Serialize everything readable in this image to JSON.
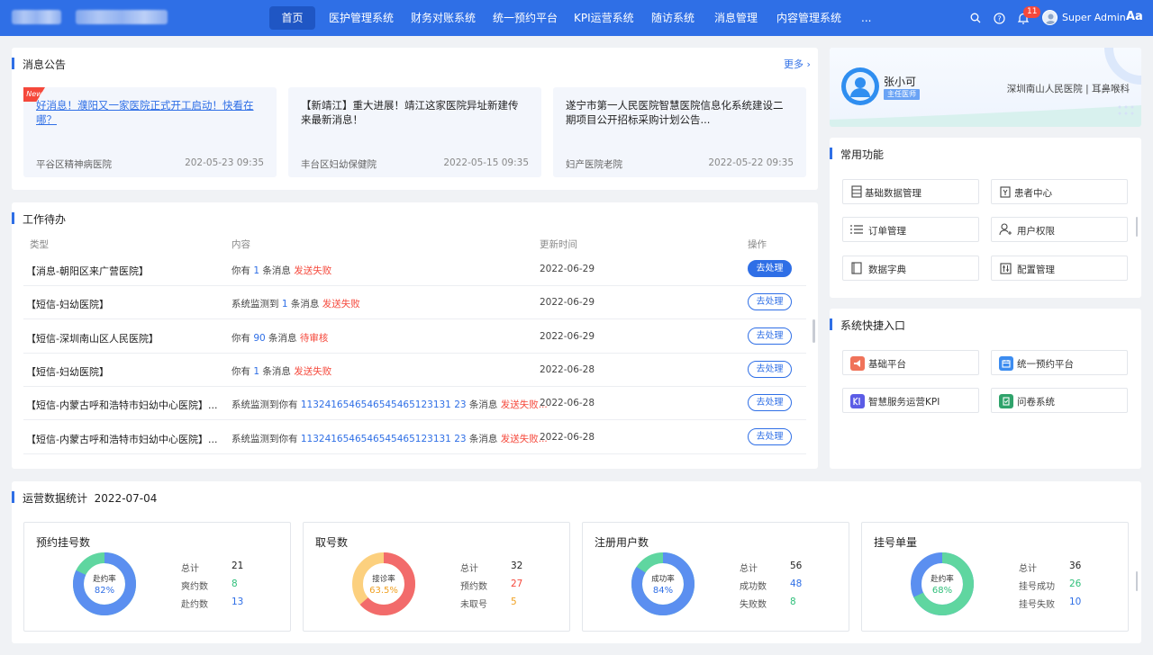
{
  "nav": {
    "items": [
      "首页",
      "医护管理系统",
      "财务对账系统",
      "统一预约平台",
      "KPI运营系统",
      "随访系统",
      "消息管理",
      "内容管理系统",
      "..."
    ],
    "active_index": 0,
    "notification_count": "11",
    "user_name": "Super Admin",
    "font_toggle": "Aa"
  },
  "notices": {
    "title": "消息公告",
    "more": "更多",
    "new_tag": "New",
    "items": [
      {
        "text": "好消息！濮阳又一家医院正式开工启动！快看在哪？",
        "source": "平谷区精神病医院",
        "time": "202-05-23 09:35"
      },
      {
        "text": "【新靖江】重大进展！靖江这家医院异址新建传来最新消息！",
        "source": "丰台区妇幼保健院",
        "time": "2022-05-15 09:35"
      },
      {
        "text": "遂宁市第一人民医院智慧医院信息化系统建设二期项目公开招标采购计划公告...",
        "source": "妇产医院老院",
        "time": "2022-05-22 09:35"
      }
    ]
  },
  "todo": {
    "title": "工作待办",
    "headers": {
      "type": "类型",
      "content": "内容",
      "time": "更新时间",
      "action": "操作"
    },
    "rows": [
      {
        "type": "【消息-朝阳区来广营医院】",
        "pre": "你有 ",
        "num": "1",
        "mid": " 条消息 ",
        "status": "发送失败",
        "time": "2022-06-29",
        "action": "去处理"
      },
      {
        "type": "【短信-妇幼医院】",
        "pre": "系统监测到 ",
        "num": "1",
        "mid": " 条消息 ",
        "status": "发送失败",
        "time": "2022-06-29",
        "action": "去处理"
      },
      {
        "type": "【短信-深圳南山区人民医院】",
        "pre": "你有 ",
        "num": "90",
        "mid": " 条消息 ",
        "status": "待审核",
        "time": "2022-06-29",
        "action": "去处理"
      },
      {
        "type": "【短信-妇幼医院】",
        "pre": "你有 ",
        "num": "1",
        "mid": " 条消息 ",
        "status": "发送失败",
        "time": "2022-06-28",
        "action": "去处理"
      },
      {
        "type": "【短信-内蒙古呼和浩特市妇幼中心医院】...",
        "pre": "系统监测到你有 ",
        "num": "1132416546546545465123131 23",
        "mid": " 条消息 ",
        "status": "发送失败...",
        "time": "2022-06-28",
        "action": "去处理"
      },
      {
        "type": "【短信-内蒙古呼和浩特市妇幼中心医院】...",
        "pre": "系统监测到你有 ",
        "num": "1132416546546545465123131 23",
        "mid": " 条消息 ",
        "status": "发送失败...",
        "time": "2022-06-28",
        "action": "去处理"
      }
    ]
  },
  "profile": {
    "name": "张小可",
    "role": "主任医师",
    "hospital": "深圳南山人民医院 | 耳鼻喉科"
  },
  "common": {
    "title": "常用功能",
    "items": [
      {
        "label": "基础数据管理",
        "icon": "database-icon"
      },
      {
        "label": "患者中心",
        "icon": "patient-icon"
      },
      {
        "label": "订单管理",
        "icon": "list-icon"
      },
      {
        "label": "用户权限",
        "icon": "user-permission-icon"
      },
      {
        "label": "数据字典",
        "icon": "dictionary-icon"
      },
      {
        "label": "配置管理",
        "icon": "settings-icon"
      }
    ]
  },
  "quick": {
    "title": "系统快捷入口",
    "items": [
      {
        "label": "基础平台",
        "icon": "megaphone-icon",
        "color": "#f0735a"
      },
      {
        "label": "统一预约平台",
        "icon": "calendar-icon",
        "color": "#3c8cf0"
      },
      {
        "label": "智慧服务运营KPI",
        "icon": "kpi-icon",
        "color": "#5b5ce6"
      },
      {
        "label": "问卷系统",
        "icon": "survey-icon",
        "color": "#2fa36b"
      }
    ]
  },
  "stats": {
    "title": "运营数据统计",
    "date": "2022-07-04",
    "cards": [
      {
        "title": "预约挂号数",
        "center_label": "赴约率",
        "center_value": "82%",
        "pct": 82,
        "main_color": "#5b8ff0",
        "rest_color": "#5fd6a0",
        "value_color": "#2f6fe6",
        "kv": [
          {
            "k": "总计",
            "v": "21",
            "c": "#222"
          },
          {
            "k": "爽约数",
            "v": "8",
            "c": "#2fbf7a"
          },
          {
            "k": "赴约数",
            "v": "13",
            "c": "#2f6fe6"
          }
        ]
      },
      {
        "title": "取号数",
        "center_label": "接诊率",
        "center_value": "63.5%",
        "pct": 63.5,
        "main_color": "#f26b6b",
        "rest_color": "#fcd07e",
        "value_color": "#f0a020",
        "kv": [
          {
            "k": "总计",
            "v": "32",
            "c": "#222"
          },
          {
            "k": "预约数",
            "v": "27",
            "c": "#f5483b"
          },
          {
            "k": "未取号",
            "v": "5",
            "c": "#f0a020"
          }
        ]
      },
      {
        "title": "注册用户数",
        "center_label": "成功率",
        "center_value": "84%",
        "pct": 84,
        "main_color": "#5b8ff0",
        "rest_color": "#5fd6a0",
        "value_color": "#2f6fe6",
        "kv": [
          {
            "k": "总计",
            "v": "56",
            "c": "#222"
          },
          {
            "k": "成功数",
            "v": "48",
            "c": "#2f6fe6"
          },
          {
            "k": "失败数",
            "v": "8",
            "c": "#2fbf7a"
          }
        ]
      },
      {
        "title": "挂号单量",
        "center_label": "赴约率",
        "center_value": "68%",
        "pct": 68,
        "main_color": "#5fd6a0",
        "rest_color": "#5b8ff0",
        "value_color": "#2fbf7a",
        "kv": [
          {
            "k": "总计",
            "v": "36",
            "c": "#222"
          },
          {
            "k": "挂号成功",
            "v": "26",
            "c": "#2fbf7a"
          },
          {
            "k": "挂号失败",
            "v": "10",
            "c": "#2f6fe6"
          }
        ]
      }
    ]
  }
}
